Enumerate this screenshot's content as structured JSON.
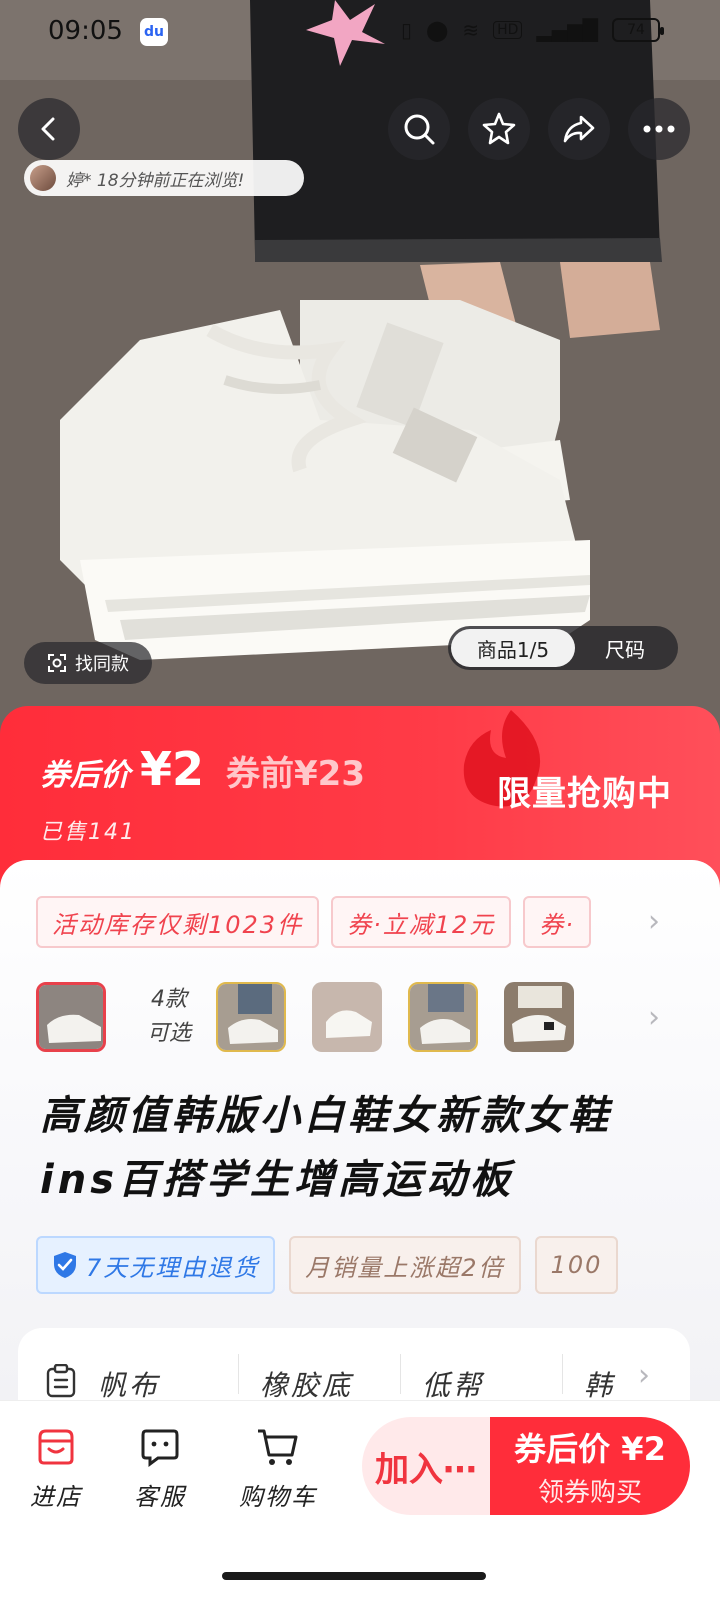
{
  "status_bar": {
    "time": "09:05",
    "app_badge": "du",
    "battery": "74"
  },
  "hero": {
    "viewer_text": "婷* 18分钟前正在浏览!",
    "find_similar": "找同款",
    "toggle_active": "商品1/5",
    "toggle_inactive": "尺码"
  },
  "price": {
    "after_label": "券后价",
    "after_value": "¥2",
    "before": "券前¥23",
    "sold": "已售141",
    "limited": "限量抢购中"
  },
  "promos": [
    "活动库存仅剩1023件",
    "券·立减12元",
    "券·"
  ],
  "variants": {
    "count_label_line1": "4款",
    "count_label_line2": "可选"
  },
  "title": "高颜值韩版小白鞋女新款女鞋ins百搭学生增高运动板",
  "services": [
    "7天无理由退货",
    "月销量上涨超2倍",
    "100"
  ],
  "specs": [
    "帆布",
    "橡胶底",
    "低帮",
    "韩"
  ],
  "bottom": {
    "tabs": [
      "进店",
      "客服",
      "购物车"
    ],
    "add_label": "加入⋯",
    "buy_top": "券后价 ¥2",
    "buy_bottom": "领券购买"
  },
  "colors": {
    "accent": "#ff2d3a",
    "accent_light": "#ffe9ea",
    "service_blue": "#2f78e6"
  },
  "icons": [
    "back-icon",
    "search-icon",
    "star-icon",
    "share-icon",
    "more-icon",
    "scan-icon",
    "shield-check-icon",
    "clipboard-icon",
    "store-icon",
    "chat-icon",
    "cart-icon",
    "chevron-right-icon"
  ]
}
